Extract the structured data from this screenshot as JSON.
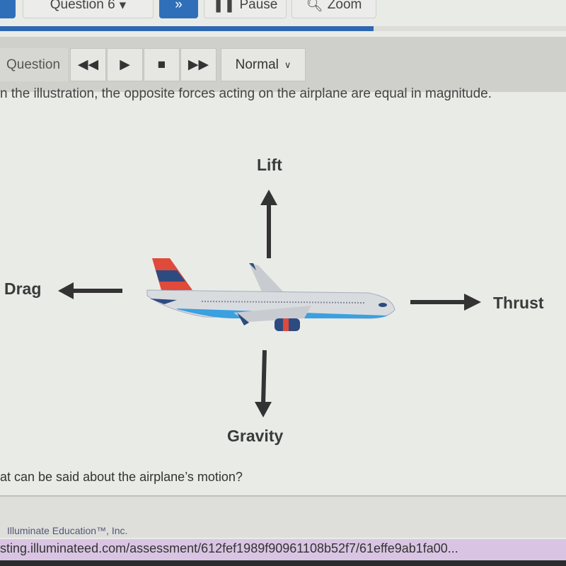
{
  "topbar": {
    "question_select": "Question 6",
    "pause": "Pause",
    "zoom": "Zoom"
  },
  "progress": {
    "percent": 66,
    "color": "#2e67b1"
  },
  "toolbar": {
    "label": "Question",
    "speed": "Normal"
  },
  "content": {
    "intro": "n the illustration, the opposite forces acting on the airplane are equal in magnitude.",
    "labels": {
      "lift": "Lift",
      "drag": "Drag",
      "thrust": "Thrust",
      "gravity": "Gravity"
    },
    "question": "at can be said about the airplane’s motion?"
  },
  "footer": {
    "brand": "Illuminate Education™, Inc."
  },
  "browser": {
    "url": "sting.illuminateed.com/assessment/612fef1989f90961108b52f7/61effe9ab1fa00..."
  }
}
